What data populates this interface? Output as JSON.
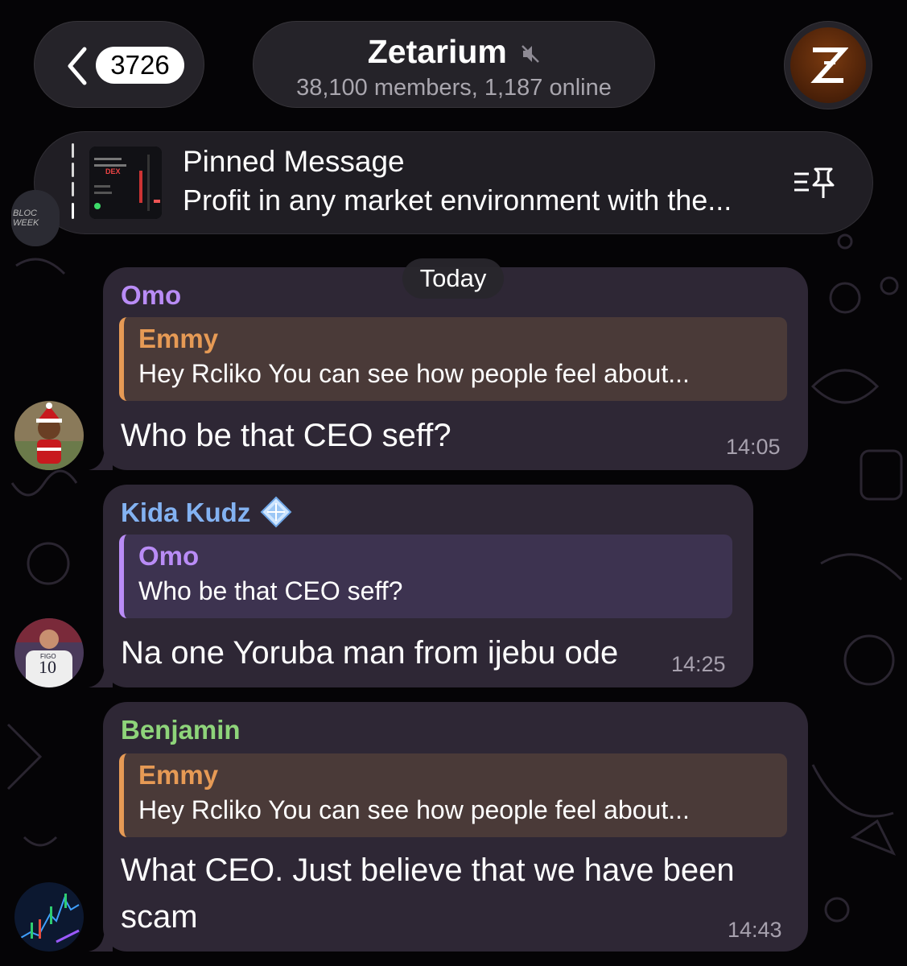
{
  "header": {
    "back_count": "3726",
    "title": "Zetarium",
    "subtitle": "38,100 members, 1,187 online",
    "muted_icon": "speaker-muted-icon",
    "avatar_letter": "Z"
  },
  "pinned": {
    "title": "Pinned Message",
    "text": "Profit in any market environment with the...",
    "thumb_text": "DEX"
  },
  "date_separator": "Today",
  "colors": {
    "omo": "#b98cf6",
    "emmy": "#e69a55",
    "kida": "#83b2f2",
    "benjamin": "#8ed47a",
    "bubble": "#2e2735"
  },
  "messages": [
    {
      "sender": "Omo",
      "reply_name": "Emmy",
      "reply_text": "Hey Rcliko You can see how people feel about...",
      "text": "Who be that CEO seff?",
      "time": "14:05"
    },
    {
      "sender": "Kida Kudz",
      "reply_name": "Omo",
      "reply_text": "Who be that CEO seff?",
      "text": "Na one Yoruba man from ijebu ode",
      "time": "14:25"
    },
    {
      "sender": "Benjamin",
      "reply_name": "Emmy",
      "reply_text": "Hey Rcliko You can see how people feel about...",
      "text_line1": "What CEO. Just believe that we have been",
      "text_line2": "scam",
      "time": "14:43"
    }
  ]
}
